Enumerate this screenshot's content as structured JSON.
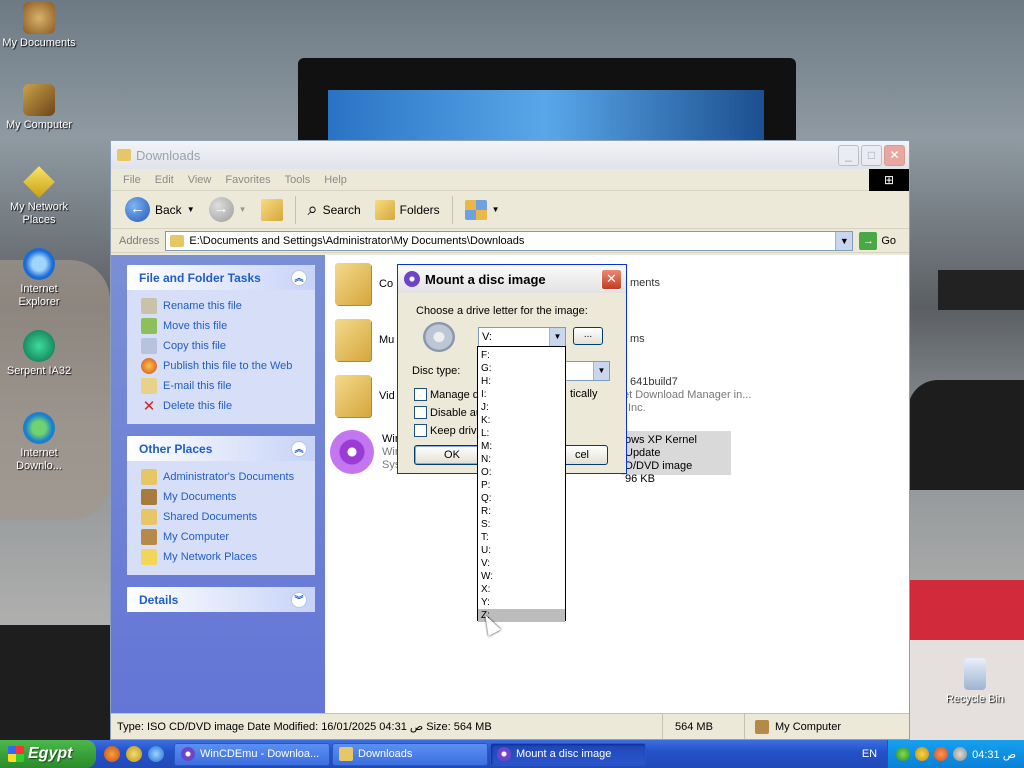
{
  "desktop": {
    "icons": [
      "My Documents",
      "My Computer",
      "My Network Places",
      "Internet Explorer",
      "Serpent IA32",
      "Internet Downlo...",
      "Recycle Bin"
    ]
  },
  "window": {
    "title": "Downloads",
    "menu": [
      "File",
      "Edit",
      "View",
      "Favorites",
      "Tools",
      "Help"
    ],
    "toolbar": {
      "back": "Back",
      "search": "Search",
      "folders": "Folders"
    },
    "address": {
      "label": "Address",
      "value": "E:\\Documents and Settings\\Administrator\\My Documents\\Downloads",
      "go": "Go"
    },
    "file_tasks": {
      "title": "File and Folder Tasks",
      "items": [
        "Rename this file",
        "Move this file",
        "Copy this file",
        "Publish this file to the Web",
        "E-mail this file",
        "Delete this file"
      ]
    },
    "other_places": {
      "title": "Other Places",
      "items": [
        "Administrator's Documents",
        "My Documents",
        "Shared Documents",
        "My Computer",
        "My Network Places"
      ]
    },
    "details": {
      "title": "Details"
    },
    "files": {
      "f1_left": "Co",
      "f1_right": "ments",
      "f2_left": "Mu",
      "f2_right": "ms",
      "f3_left": "Vid",
      "f3_right1": "641build7",
      "f3_right2": "et Download Manager in...",
      "f3_right3": "Inc.",
      "f4_left1": "Win",
      "f4_left2": "Win",
      "f4_left3": "Sys",
      "f4_right1": "ows XP Kernel Update",
      "f4_right2": "D/DVD image",
      "f4_right3": "96 KB"
    },
    "status": {
      "info": "Type: ISO CD/DVD image Date Modified: 16/01/2025 04:31 ص Size: 564 MB",
      "size": "564 MB",
      "location": "My Computer"
    }
  },
  "dialog": {
    "title": "Mount a disc image",
    "drive_prompt": "Choose a drive letter for the image:",
    "drive_value": "V:",
    "browse": "...",
    "disc_type_label": "Disc type:",
    "checkboxes": {
      "manage_a": "Manage d",
      "manage_b": "tically",
      "disable": "Disable au",
      "keep": "Keep drive"
    },
    "ok": "OK",
    "cancel": "cel",
    "drive_letters": [
      "F:",
      "G:",
      "H:",
      "I:",
      "J:",
      "K:",
      "L:",
      "M:",
      "N:",
      "O:",
      "P:",
      "Q:",
      "R:",
      "S:",
      "T:",
      "U:",
      "V:",
      "W:",
      "X:",
      "Y:",
      "Z:"
    ]
  },
  "taskbar": {
    "start": "Egypt",
    "tasks": [
      "WinCDEmu - Downloa...",
      "Downloads",
      "Mount a disc image"
    ],
    "lang": "EN",
    "clock": "04:31 ص"
  }
}
